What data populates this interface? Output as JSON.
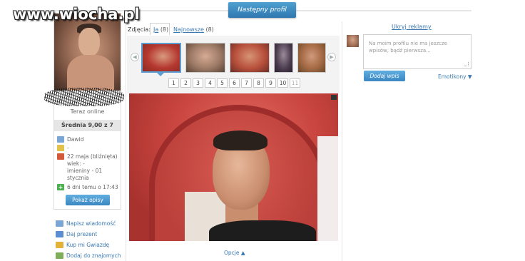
{
  "watermark": "www.wiocha.pl",
  "header": {
    "next_profile": "Następny profil"
  },
  "profile": {
    "status": "Teraz online",
    "rating": "Średnia 9,00 z 7",
    "info": {
      "name": "Dawid",
      "flag": "-",
      "birthday": "22 maja (bliźnięta)",
      "age": "wiek: -",
      "nameday_a": "imieniny - 01",
      "nameday_b": "stycznia",
      "last_seen": "6 dni temu o 17:43"
    },
    "show_descriptions": "Pokaż opisy"
  },
  "left_links": [
    {
      "label": "Napisz wiadomość",
      "icon": "mail-icon"
    },
    {
      "label": "Daj prezent",
      "icon": "gift-icon"
    },
    {
      "label": "Kup mi Gwiazdę",
      "icon": "star-icon"
    },
    {
      "label": "Dodaj do znajomych",
      "icon": "add-friend-icon"
    }
  ],
  "photos": {
    "label": "Zdjęcia:",
    "tab_me": {
      "link": "Ja",
      "count": "(8)"
    },
    "tab_new": {
      "link": "Najnowsze",
      "count": "(8)"
    },
    "pages": [
      "1",
      "2",
      "3",
      "4",
      "5",
      "6",
      "7",
      "8",
      "9",
      "10",
      "11"
    ],
    "options": "Opcje ▲"
  },
  "right": {
    "hide_ads": "Ukryj reklamy",
    "comment_placeholder_1": "Na moim profilu nie ma jeszcze",
    "comment_placeholder_2": "wpisów, bądź pierwsza...",
    "add_entry": "Dodaj wpis",
    "emoticons": "Emotikony ▼"
  },
  "colors": {
    "accent": "#3a86c2",
    "link": "#3a78b0",
    "photo_wall": "#c9453f"
  }
}
